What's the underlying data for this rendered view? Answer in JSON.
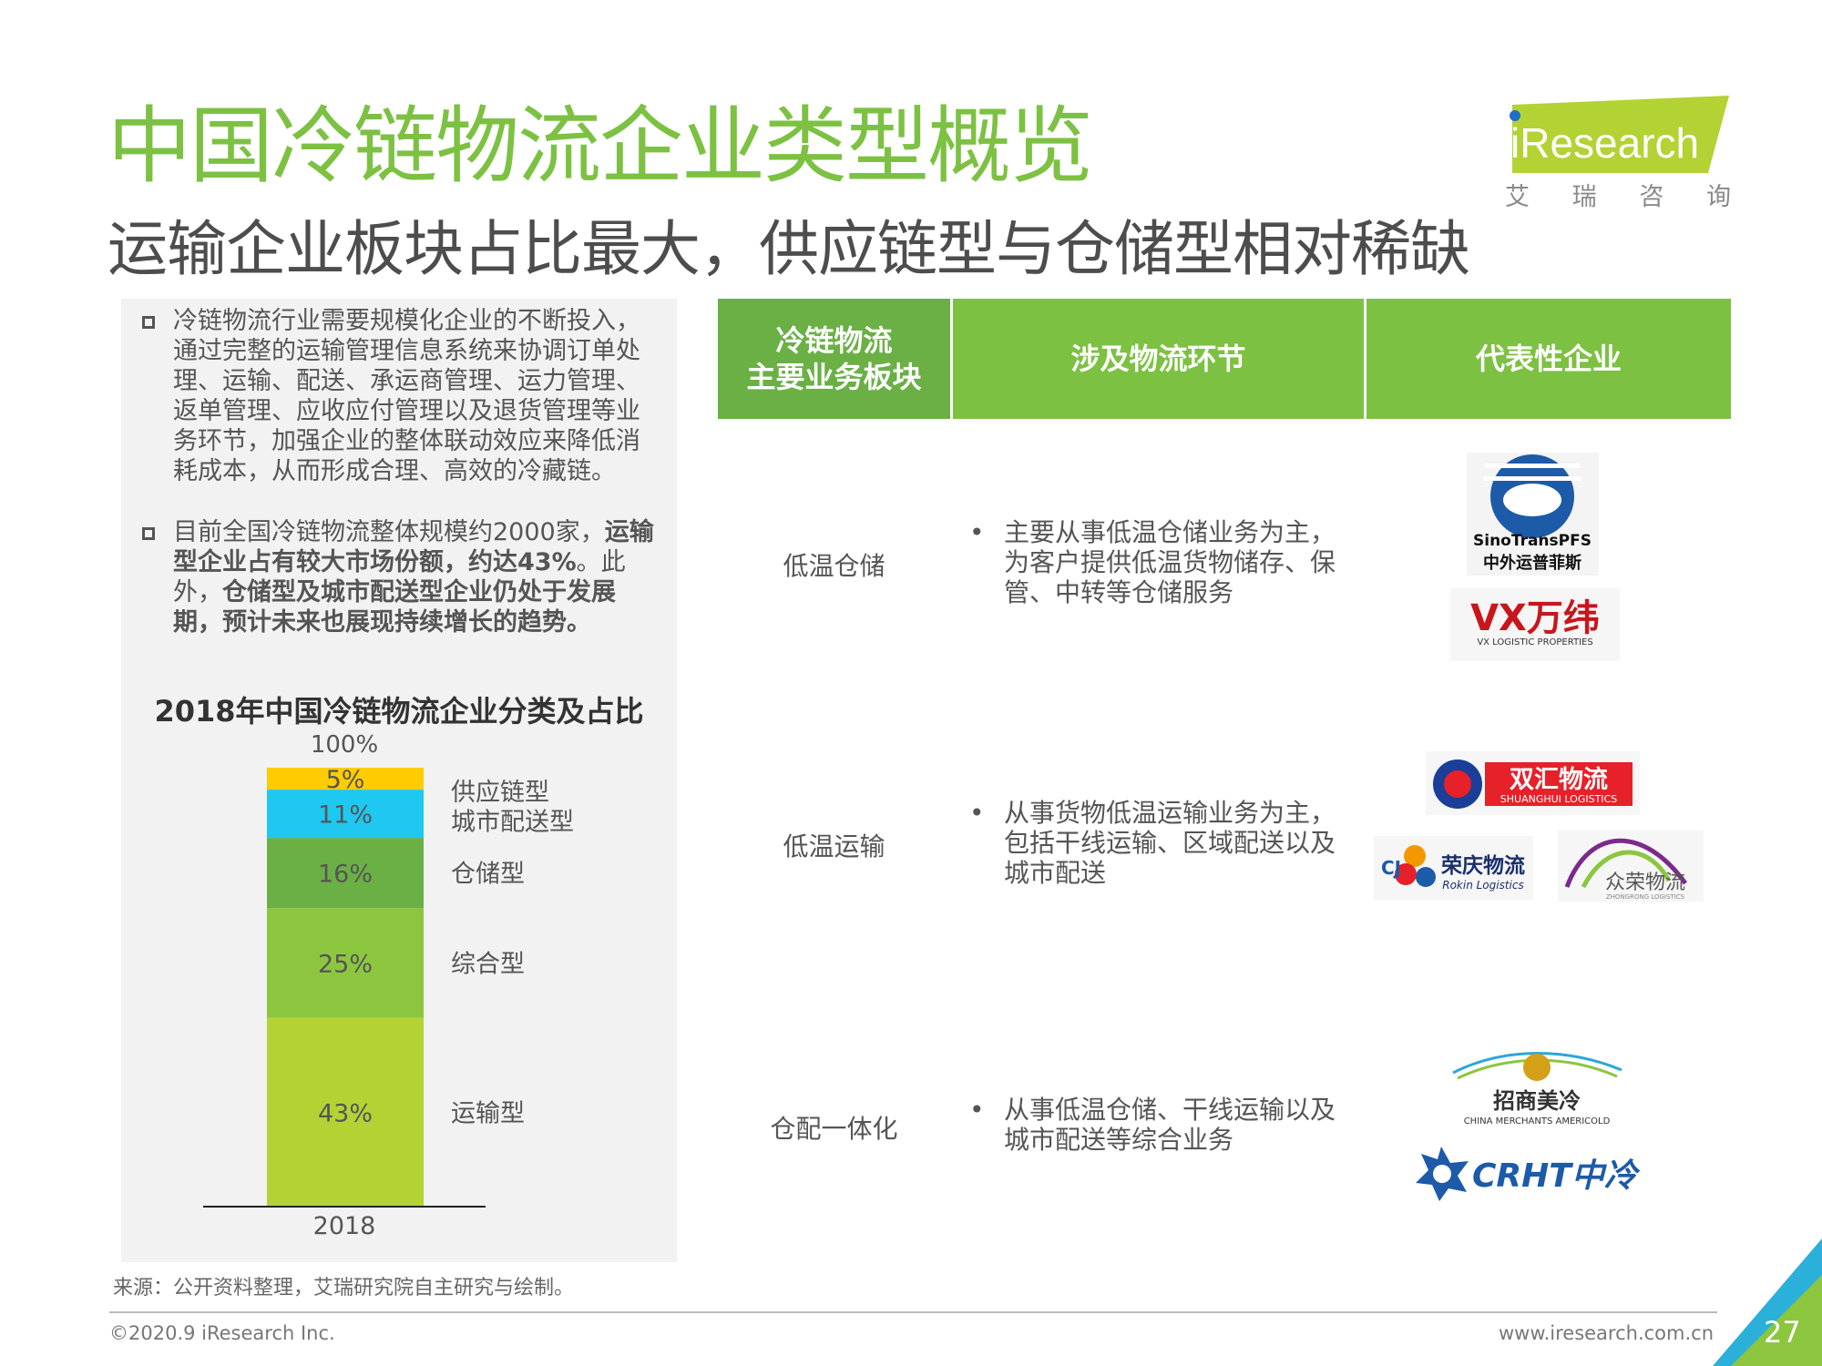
{
  "header": {
    "title": "中国冷链物流企业类型概览",
    "subtitle": "运输企业板块占比最大，供应链型与仓储型相对稀缺",
    "logo_text": "iResearch",
    "logo_subtitle": [
      "艾",
      "瑞",
      "咨",
      "询"
    ]
  },
  "left_panel": {
    "bullet1": "冷链物流行业需要规模化企业的不断投入，通过完整的运输管理信息系统来协调订单处理、运输、配送、承运商管理、运力管理、返单管理、应收应付管理以及退货管理等业务环节，加强企业的整体联动效应来降低消耗成本，从而形成合理、高效的冷藏链。",
    "bullet2_parts": {
      "p1": "目前全国冷链物流整体规模约2000家，",
      "p2": "运输型企业占有较大市场份额，约达43%",
      "p3": "。此外，",
      "p4": "仓储型及城市配送型企业仍处于发展期，预计未来也展现持续增长的趋势。"
    }
  },
  "chart_data": {
    "type": "bar",
    "stacked": true,
    "title": "2018年中国冷链物流企业分类及占比",
    "categories": [
      "2018"
    ],
    "ylim": [
      0,
      100
    ],
    "top_label": "100%",
    "series": [
      {
        "name": "运输型",
        "values": [
          43
        ],
        "label": "43%",
        "color": "#b3d234"
      },
      {
        "name": "综合型",
        "values": [
          25
        ],
        "label": "25%",
        "color": "#8cc63f"
      },
      {
        "name": "仓储型",
        "values": [
          16
        ],
        "label": "16%",
        "color": "#6ab045"
      },
      {
        "name": "城市配送型",
        "values": [
          11
        ],
        "label": "11%",
        "color": "#1ec8f0"
      },
      {
        "name": "供应链型",
        "values": [
          5
        ],
        "label": "5%",
        "color": "#ffcc00"
      }
    ]
  },
  "table": {
    "headers": [
      "冷链物流\n主要业务板块",
      "涉及物流环节",
      "代表性企业"
    ],
    "rows": [
      {
        "category": "低温仓储",
        "bullet": "•",
        "description": "主要从事低温仓储业务为主，为客户提供低温货物储存、保管、中转等仓储服务",
        "companies": [
          {
            "name": "SinoTransPFS",
            "subname": "中外运普菲斯"
          },
          {
            "name": "VX万纬",
            "subname": "VX LOGISTIC PROPERTIES"
          }
        ]
      },
      {
        "category": "低温运输",
        "bullet": "•",
        "description": "从事货物低温运输业务为主，包括干线运输、区域配送以及城市配送",
        "companies": [
          {
            "name": "双汇物流",
            "subname": "SHUANGHUI LOGISTICS"
          },
          {
            "name": "荣庆物流",
            "subname": "Rokin Logistics"
          },
          {
            "name": "众荣物流",
            "subname": "ZHONGRONG LOGISTICS"
          }
        ]
      },
      {
        "category": "仓配一体化",
        "bullet": "•",
        "description": "从事低温仓储、干线运输以及城市配送等综合业务",
        "companies": [
          {
            "name": "招商美冷",
            "subname": "CHINA MERCHANTS AMERICOLD"
          },
          {
            "name": "CRHT中冷",
            "subname": ""
          }
        ]
      }
    ]
  },
  "footer": {
    "source": "来源：公开资料整理，艾瑞研究院自主研究与绘制。",
    "copyright": "©2020.9 iResearch Inc.",
    "website": "www.iresearch.com.cn",
    "page_number": "27"
  },
  "colors": {
    "accent": "#7dc143",
    "header_dark": "#6ab045"
  }
}
